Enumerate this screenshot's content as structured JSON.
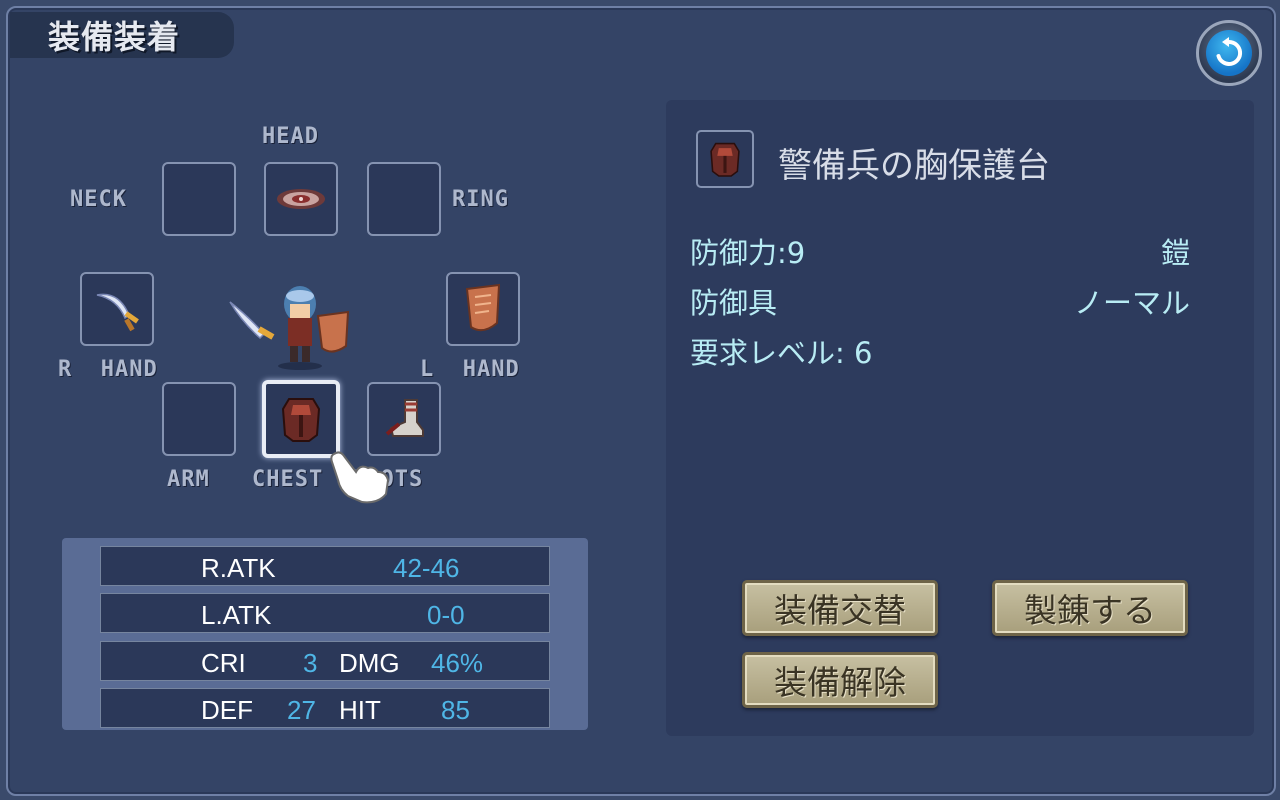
{
  "header": {
    "title": "装備装着"
  },
  "slots": {
    "head": {
      "label": "HEAD",
      "icon": "helmet-icon"
    },
    "neck": {
      "label": "NECK",
      "icon": ""
    },
    "ring": {
      "label": "RING",
      "icon": ""
    },
    "r_hand": {
      "label": "R  HAND",
      "icon": "scimitar-icon"
    },
    "l_hand": {
      "label": "L  HAND",
      "icon": "shield-icon"
    },
    "arm": {
      "label": "ARM",
      "icon": ""
    },
    "chest": {
      "label": "CHEST",
      "icon": "chest-armor-icon"
    },
    "boots": {
      "label": "BOOTS",
      "icon": "boots-icon"
    }
  },
  "stats": {
    "r_atk": {
      "label": "R.ATK",
      "value": "42-46"
    },
    "l_atk": {
      "label": "L.ATK",
      "value": "0-0"
    },
    "cri": {
      "label": "CRI",
      "value": "3"
    },
    "dmg": {
      "label": "DMG",
      "value": "46%"
    },
    "def": {
      "label": "DEF",
      "value": "27"
    },
    "hit": {
      "label": "HIT",
      "value": "85"
    }
  },
  "detail": {
    "item_name": "警備兵の胸保護台",
    "defense": "防御力:9",
    "category": "鎧",
    "type": "防御具",
    "rarity": "ノーマル",
    "required_level": "要求レベル: 6"
  },
  "actions": {
    "swap": "装備交替",
    "refine": "製錬する",
    "unequip": "装備解除"
  },
  "colors": {
    "background": "#344466",
    "panel": "#2d3b5d",
    "stat_value": "#4fb6e6",
    "detail_text": "#b8ecf4",
    "button": "#c7c0a2"
  }
}
